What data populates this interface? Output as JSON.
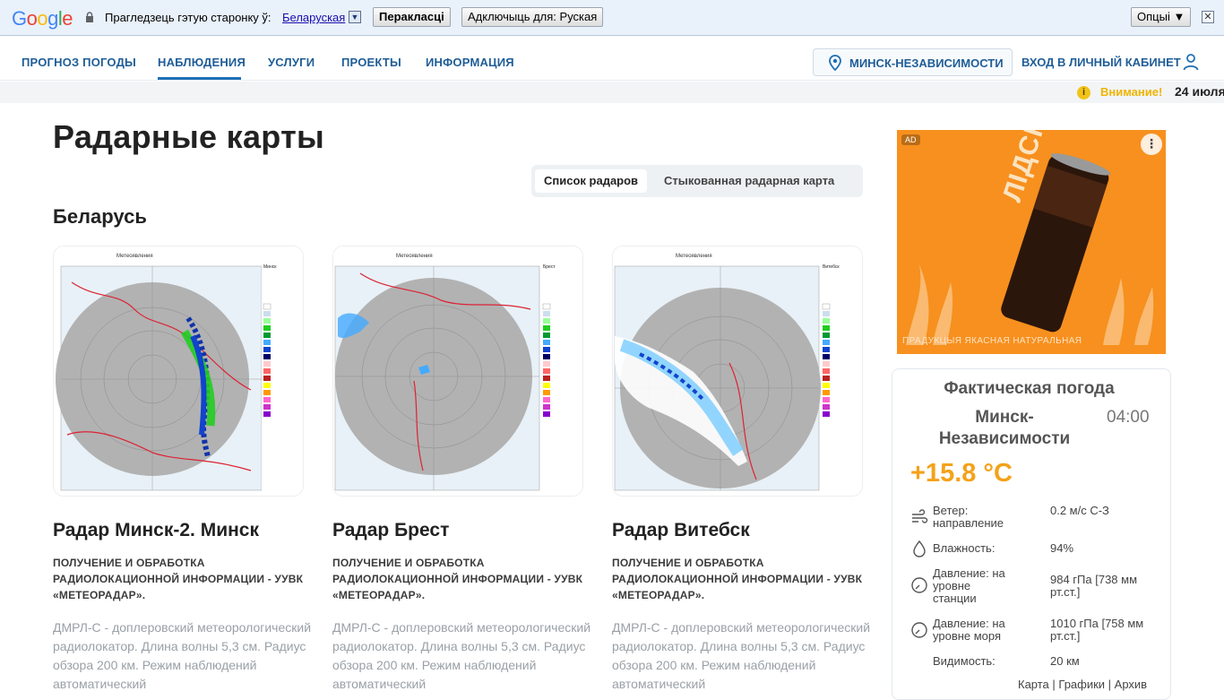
{
  "translate_bar": {
    "prompt": "Прагледзець гэтую старонку ў:",
    "language": "Беларуская",
    "translate_button": "Перакласці",
    "disable_button": "Адключыць для: Руская",
    "options_button": "Опцыі ▼",
    "close": "✕"
  },
  "nav": {
    "items": [
      {
        "label": "ПРОГНОЗ ПОГОДЫ"
      },
      {
        "label": "НАБЛЮДЕНИЯ"
      },
      {
        "label": "УСЛУГИ"
      },
      {
        "label": "ПРОЕКТЫ"
      },
      {
        "label": "ИНФОРМАЦИЯ"
      }
    ],
    "active": "НАБЛЮДЕНИЯ",
    "location": "МИНСК-НЕЗАВИСИМОСТИ",
    "login": "ВХОД В ЛИЧНЫЙ КАБИНЕТ"
  },
  "alert": {
    "label": "Внимание!",
    "date": "24 июля"
  },
  "page": {
    "title": "Радарные карты",
    "toggle": [
      "Список радаров",
      "Стыкованная радарная карта"
    ],
    "section": "Беларусь"
  },
  "radars": [
    {
      "title": "Радар Минск-2. Минск",
      "subtitle": "ПОЛУЧЕНИЕ И ОБРАБОТКА РАДИОЛОКАЦИОННОЙ ИНФОРМАЦИИ - УУВК «МЕТЕОРАДАР».",
      "description": "ДМРЛ-С - доплеровский метеорологический радиолокатор. Длина волны 5,3 см. Радиус обзора 200 км. Режим наблюдений автоматический",
      "map_header": "Метеоявления",
      "station": "Минск"
    },
    {
      "title": "Радар Брест",
      "subtitle": "ПОЛУЧЕНИЕ И ОБРАБОТКА РАДИОЛОКАЦИОННОЙ ИНФОРМАЦИИ - УУВК «МЕТЕОРАДАР».",
      "description": "ДМРЛ-С - доплеровский метеорологический радиолокатор. Длина волны 5,3 см. Радиус обзора 200 км. Режим наблюдений автоматический",
      "map_header": "Метеоявления",
      "station": "Брест"
    },
    {
      "title": "Радар Витебск",
      "subtitle": "ПОЛУЧЕНИЕ И ОБРАБОТКА РАДИОЛОКАЦИОННОЙ ИНФОРМАЦИИ - УУВК «МЕТЕОРАДАР».",
      "description": "ДМРЛ-С - доплеровский метеорологический радиолокатор. Длина волны 5,3 см. Радиус обзора 200 км. Режим наблюдений автоматический",
      "map_header": "Метеоявления",
      "station": "Витебск"
    }
  ],
  "ad": {
    "badge": "AD",
    "brand": "ЛІДСКАЕ",
    "footer": "ПРАДУКЦЫЯ ЯКАСНАЯ НАТУРАЛЬНАЯ"
  },
  "weather": {
    "title": "Фактическая погода",
    "station": "Минск-Независимости",
    "time": "04:00",
    "temperature": "+15.8 °C",
    "rows": [
      {
        "label": "Ветер: направление",
        "value": "0.2 м/с С-З"
      },
      {
        "label": "Влажность:",
        "value": "94%"
      },
      {
        "label": "Давление: на уровне станции",
        "value": "984 гПа [738 мм рт.ст.]"
      },
      {
        "label": "Давление: на уровне моря",
        "value": "1010 гПа [758 мм рт.ст.]"
      },
      {
        "label": "Видимость:",
        "value": "20 км"
      }
    ],
    "links": "Карта | Графики | Архив"
  },
  "colors": {
    "nav_text": "#1f5d97",
    "alert": "#f0b400",
    "temp": "#f4a21a",
    "ad_bg": "#f7901e"
  }
}
